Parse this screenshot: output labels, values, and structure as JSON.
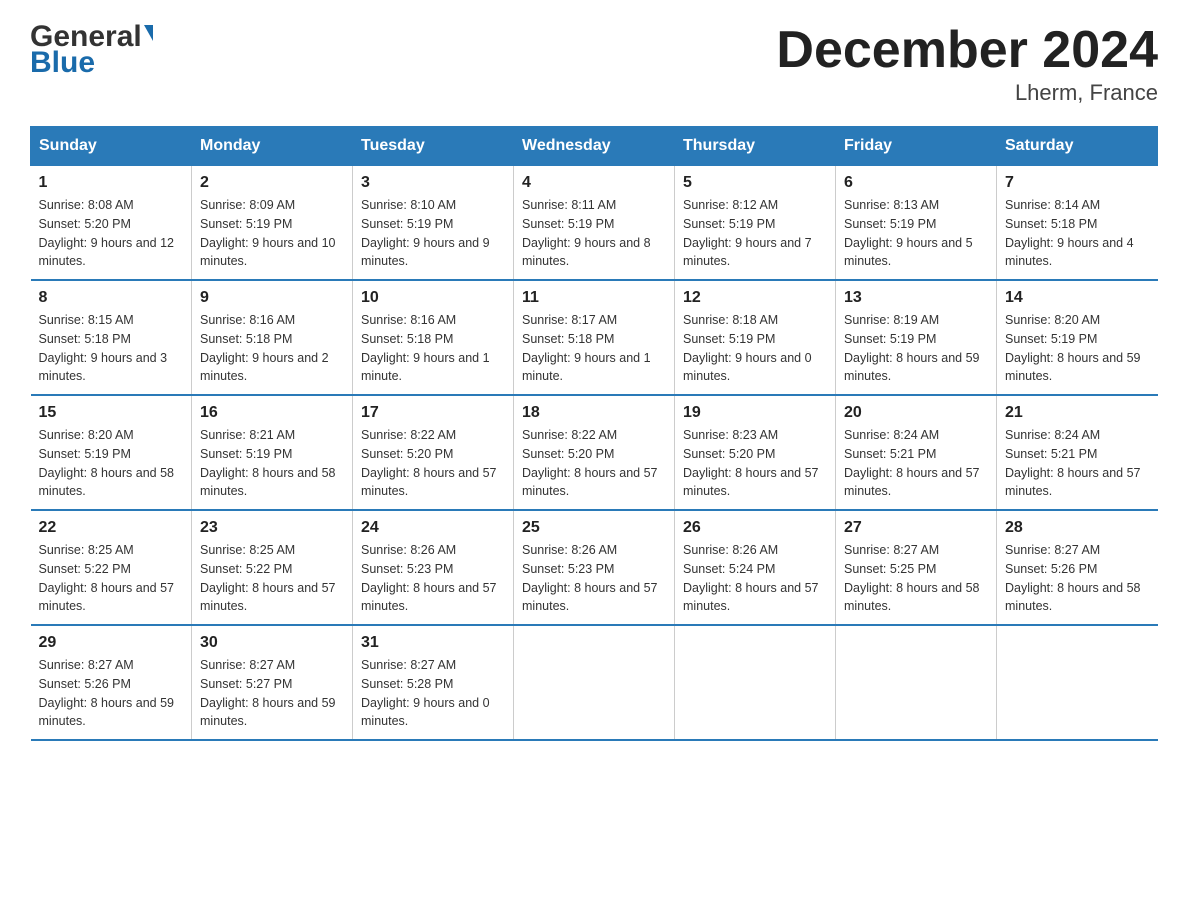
{
  "header": {
    "logo_general": "General",
    "logo_blue": "Blue",
    "month_title": "December 2024",
    "location": "Lherm, France"
  },
  "calendar": {
    "days_of_week": [
      "Sunday",
      "Monday",
      "Tuesday",
      "Wednesday",
      "Thursday",
      "Friday",
      "Saturday"
    ],
    "weeks": [
      [
        {
          "day": "1",
          "sunrise": "8:08 AM",
          "sunset": "5:20 PM",
          "daylight": "9 hours and 12 minutes."
        },
        {
          "day": "2",
          "sunrise": "8:09 AM",
          "sunset": "5:19 PM",
          "daylight": "9 hours and 10 minutes."
        },
        {
          "day": "3",
          "sunrise": "8:10 AM",
          "sunset": "5:19 PM",
          "daylight": "9 hours and 9 minutes."
        },
        {
          "day": "4",
          "sunrise": "8:11 AM",
          "sunset": "5:19 PM",
          "daylight": "9 hours and 8 minutes."
        },
        {
          "day": "5",
          "sunrise": "8:12 AM",
          "sunset": "5:19 PM",
          "daylight": "9 hours and 7 minutes."
        },
        {
          "day": "6",
          "sunrise": "8:13 AM",
          "sunset": "5:19 PM",
          "daylight": "9 hours and 5 minutes."
        },
        {
          "day": "7",
          "sunrise": "8:14 AM",
          "sunset": "5:18 PM",
          "daylight": "9 hours and 4 minutes."
        }
      ],
      [
        {
          "day": "8",
          "sunrise": "8:15 AM",
          "sunset": "5:18 PM",
          "daylight": "9 hours and 3 minutes."
        },
        {
          "day": "9",
          "sunrise": "8:16 AM",
          "sunset": "5:18 PM",
          "daylight": "9 hours and 2 minutes."
        },
        {
          "day": "10",
          "sunrise": "8:16 AM",
          "sunset": "5:18 PM",
          "daylight": "9 hours and 1 minute."
        },
        {
          "day": "11",
          "sunrise": "8:17 AM",
          "sunset": "5:18 PM",
          "daylight": "9 hours and 1 minute."
        },
        {
          "day": "12",
          "sunrise": "8:18 AM",
          "sunset": "5:19 PM",
          "daylight": "9 hours and 0 minutes."
        },
        {
          "day": "13",
          "sunrise": "8:19 AM",
          "sunset": "5:19 PM",
          "daylight": "8 hours and 59 minutes."
        },
        {
          "day": "14",
          "sunrise": "8:20 AM",
          "sunset": "5:19 PM",
          "daylight": "8 hours and 59 minutes."
        }
      ],
      [
        {
          "day": "15",
          "sunrise": "8:20 AM",
          "sunset": "5:19 PM",
          "daylight": "8 hours and 58 minutes."
        },
        {
          "day": "16",
          "sunrise": "8:21 AM",
          "sunset": "5:19 PM",
          "daylight": "8 hours and 58 minutes."
        },
        {
          "day": "17",
          "sunrise": "8:22 AM",
          "sunset": "5:20 PM",
          "daylight": "8 hours and 57 minutes."
        },
        {
          "day": "18",
          "sunrise": "8:22 AM",
          "sunset": "5:20 PM",
          "daylight": "8 hours and 57 minutes."
        },
        {
          "day": "19",
          "sunrise": "8:23 AM",
          "sunset": "5:20 PM",
          "daylight": "8 hours and 57 minutes."
        },
        {
          "day": "20",
          "sunrise": "8:24 AM",
          "sunset": "5:21 PM",
          "daylight": "8 hours and 57 minutes."
        },
        {
          "day": "21",
          "sunrise": "8:24 AM",
          "sunset": "5:21 PM",
          "daylight": "8 hours and 57 minutes."
        }
      ],
      [
        {
          "day": "22",
          "sunrise": "8:25 AM",
          "sunset": "5:22 PM",
          "daylight": "8 hours and 57 minutes."
        },
        {
          "day": "23",
          "sunrise": "8:25 AM",
          "sunset": "5:22 PM",
          "daylight": "8 hours and 57 minutes."
        },
        {
          "day": "24",
          "sunrise": "8:26 AM",
          "sunset": "5:23 PM",
          "daylight": "8 hours and 57 minutes."
        },
        {
          "day": "25",
          "sunrise": "8:26 AM",
          "sunset": "5:23 PM",
          "daylight": "8 hours and 57 minutes."
        },
        {
          "day": "26",
          "sunrise": "8:26 AM",
          "sunset": "5:24 PM",
          "daylight": "8 hours and 57 minutes."
        },
        {
          "day": "27",
          "sunrise": "8:27 AM",
          "sunset": "5:25 PM",
          "daylight": "8 hours and 58 minutes."
        },
        {
          "day": "28",
          "sunrise": "8:27 AM",
          "sunset": "5:26 PM",
          "daylight": "8 hours and 58 minutes."
        }
      ],
      [
        {
          "day": "29",
          "sunrise": "8:27 AM",
          "sunset": "5:26 PM",
          "daylight": "8 hours and 59 minutes."
        },
        {
          "day": "30",
          "sunrise": "8:27 AM",
          "sunset": "5:27 PM",
          "daylight": "8 hours and 59 minutes."
        },
        {
          "day": "31",
          "sunrise": "8:27 AM",
          "sunset": "5:28 PM",
          "daylight": "9 hours and 0 minutes."
        },
        null,
        null,
        null,
        null
      ]
    ]
  }
}
